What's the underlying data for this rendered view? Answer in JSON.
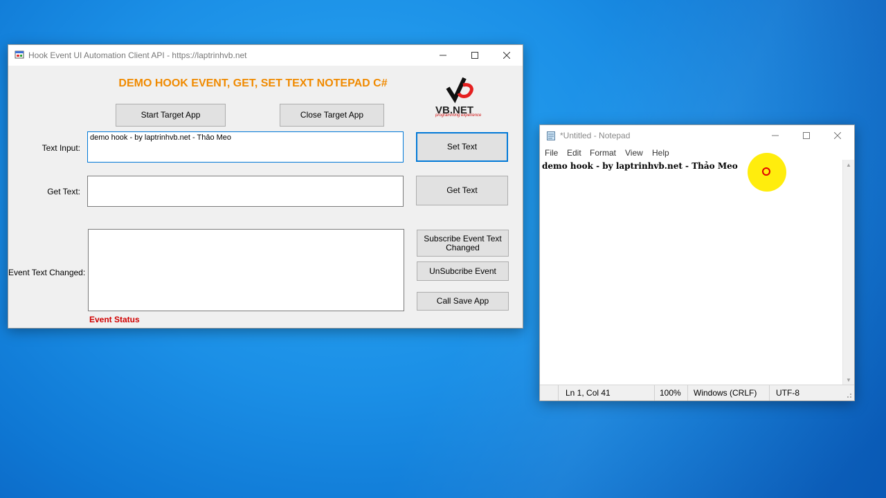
{
  "app": {
    "title": "Hook Event UI Automation Client API - https://laptrinhvb.net",
    "heading": "DEMO HOOK EVENT, GET, SET TEXT NOTEPAD C#",
    "logo_text": "VB.NET",
    "logo_sub": "programming experience",
    "buttons": {
      "start": "Start Target App",
      "close": "Close Target App",
      "set_text": "Set Text",
      "get_text": "Get Text",
      "subscribe": "Subscribe Event Text Changed",
      "unsubscribe": "UnSubcribe Event",
      "call_save": "Call Save App"
    },
    "labels": {
      "text_input": "Text Input:",
      "get_text": "Get Text:",
      "event_text_changed": "Event Text Changed:"
    },
    "fields": {
      "text_input_value": "demo hook - by laptrinhvb.net - Thảo Meo",
      "get_text_value": "",
      "event_text_value": ""
    },
    "status": "Event Status"
  },
  "notepad": {
    "title": "*Untitled - Notepad",
    "menu": [
      "File",
      "Edit",
      "Format",
      "View",
      "Help"
    ],
    "content": "demo hook - by laptrinhvb.net - Thảo Meo",
    "status": {
      "position": "Ln 1, Col 41",
      "zoom": "100%",
      "line_ending": "Windows (CRLF)",
      "encoding": "UTF-8"
    }
  },
  "colors": {
    "heading": "#f08a00",
    "status": "#d00000",
    "focus_border": "#0078d7",
    "cursor_highlight": "#ffec00"
  }
}
